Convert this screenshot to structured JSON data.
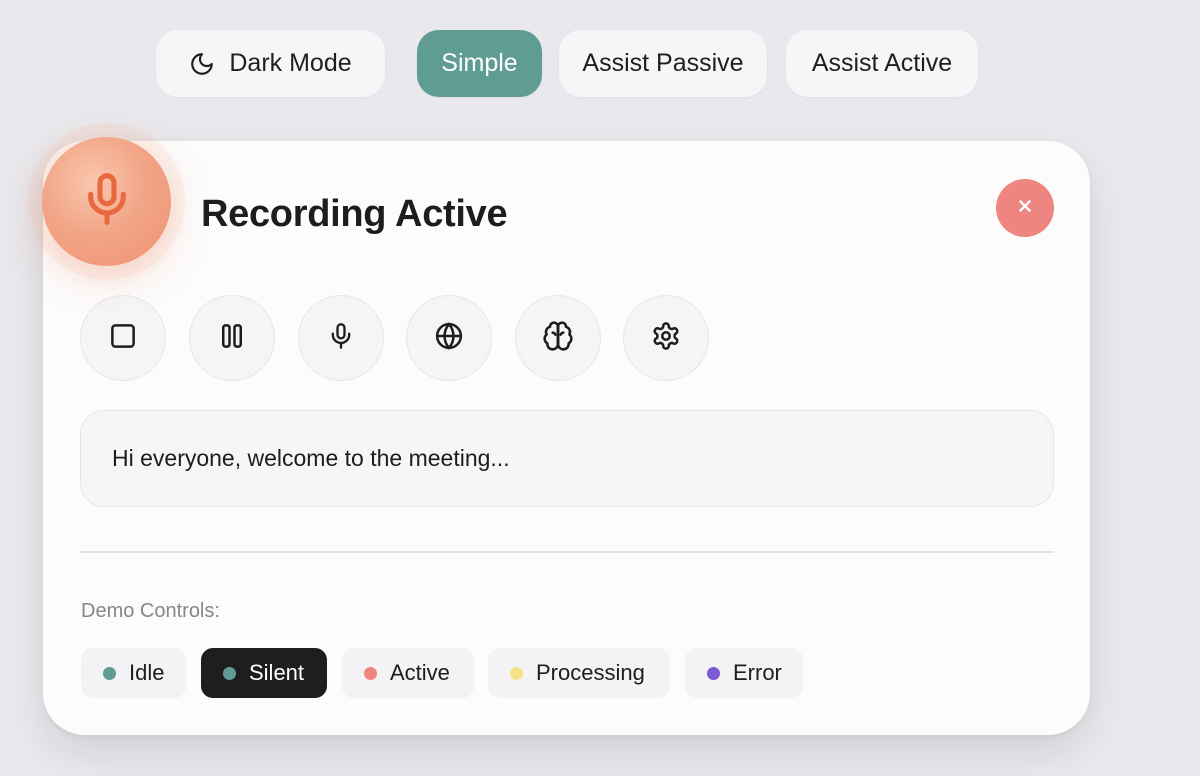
{
  "mode_bar": {
    "dark_mode_label": "Dark Mode",
    "simple_label": "Simple",
    "assist_passive_label": "Assist Passive",
    "assist_active_label": "Assist Active",
    "selected": "Simple"
  },
  "card": {
    "title": "Recording Active",
    "tools": [
      "stop-icon",
      "pause-icon",
      "mic-icon",
      "globe-icon",
      "brain-icon",
      "settings-icon"
    ],
    "transcript": "Hi everyone, welcome to the meeting...",
    "demo_label": "Demo Controls:",
    "demo_states": [
      {
        "label": "Idle",
        "color": "#5f9c94"
      },
      {
        "label": "Silent",
        "color": "#5f9c94",
        "selected": true
      },
      {
        "label": "Active",
        "color": "#ef8580"
      },
      {
        "label": "Processing",
        "color": "#f7e08a"
      },
      {
        "label": "Error",
        "color": "#7c5bd0"
      }
    ]
  },
  "colors": {
    "accent": "#5f9c94",
    "recording": "#ee9271",
    "close": "#ef8580",
    "selected_chip": "#1e1e20"
  }
}
